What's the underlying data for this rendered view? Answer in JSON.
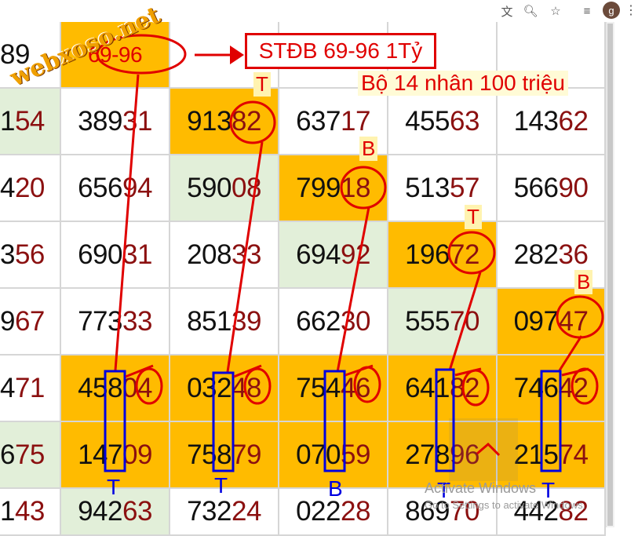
{
  "browser": {
    "icons": [
      "translate-icon",
      "zoom-icon",
      "star-icon",
      "reading-list-icon"
    ],
    "avatar_letter": "g"
  },
  "watermark": "webxoso.net",
  "header_row": {
    "first": "89",
    "second": "69-96"
  },
  "annotations": {
    "stdb_box": "STĐB 69-96 1Tỷ",
    "bo14": "Bộ 14 nhân 100 triệu",
    "top_labels": [
      "T",
      "B",
      "T",
      "B"
    ],
    "bottom_labels": [
      "T",
      "T",
      "B",
      "T",
      "T"
    ]
  },
  "rows": [
    [
      "154",
      "38931",
      "91382",
      "63717",
      "45563",
      "14362"
    ],
    [
      "420",
      "65694",
      "59008",
      "79918",
      "51357",
      "56690"
    ],
    [
      "356",
      "69031",
      "20833",
      "69492",
      "19672",
      "28236"
    ],
    [
      "967",
      "77333",
      "85139",
      "66230",
      "55570",
      "09747"
    ],
    [
      "471",
      "45804",
      "03248",
      "75446",
      "64182",
      "74642"
    ],
    [
      "675",
      "14709",
      "75879",
      "07059",
      "27896",
      "21574"
    ],
    [
      "143",
      "94263",
      "73224",
      "02228",
      "86970",
      "44282"
    ]
  ],
  "activation": {
    "line1": "Activate Windows",
    "line2": "Go to Settings to activate Windows."
  },
  "colors": {
    "orange": "#ffbb00",
    "green": "#e2efd9",
    "red": "#e00000",
    "blue": "#0000e0",
    "number_tail": "#8b1010"
  }
}
